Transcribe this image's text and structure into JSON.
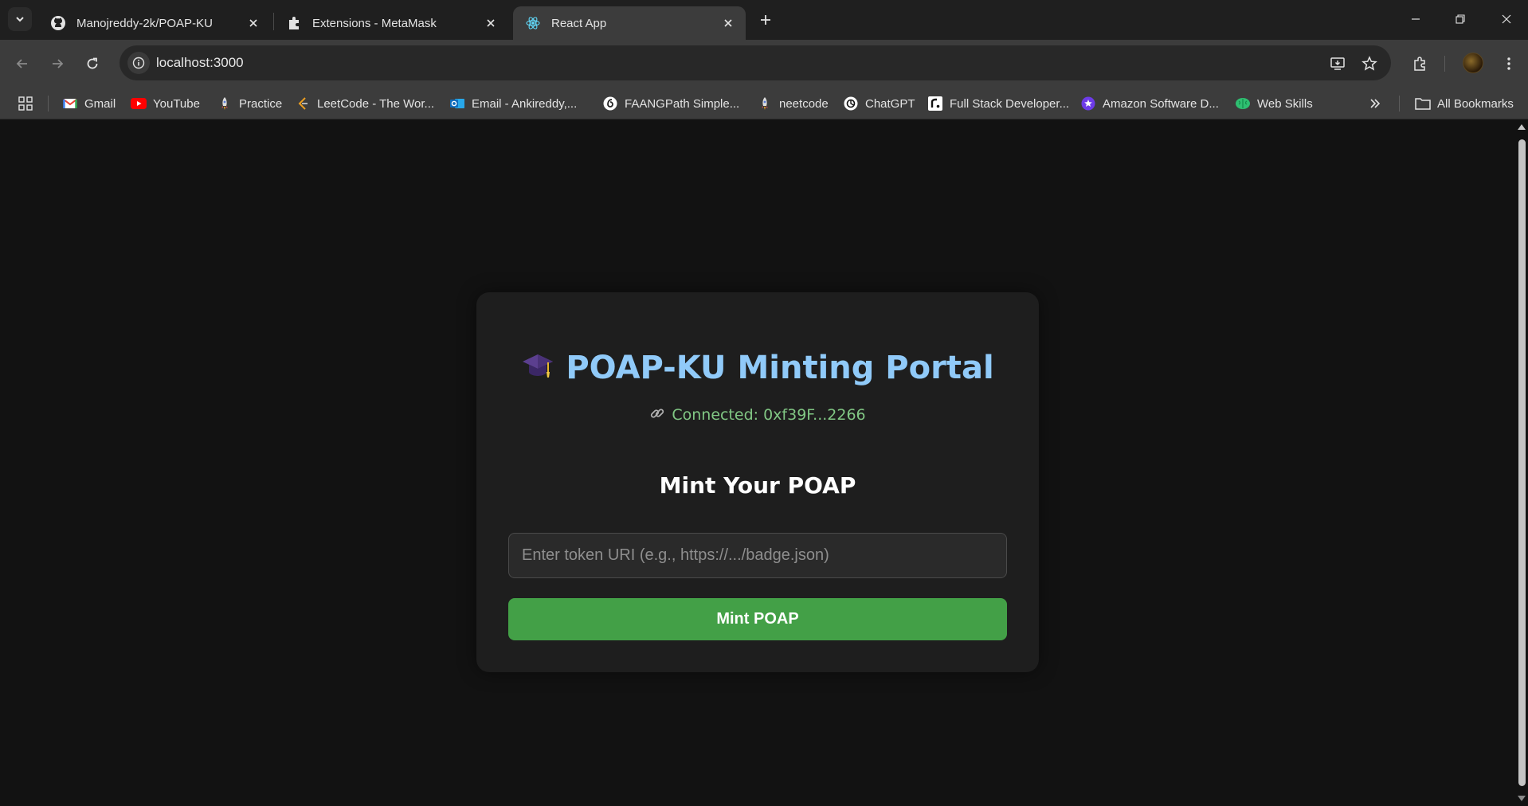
{
  "browser": {
    "tabs": [
      {
        "title": "Manojreddy-2k/POAP-KU",
        "icon": "github-icon"
      },
      {
        "title": "Extensions - MetaMask",
        "icon": "puzzle-icon"
      },
      {
        "title": "React App",
        "icon": "react-icon",
        "active": true
      }
    ],
    "url": "localhost:3000",
    "bookmarks": [
      {
        "label": "Gmail",
        "icon": "gmail-icon"
      },
      {
        "label": "YouTube",
        "icon": "youtube-icon"
      },
      {
        "label": "Practice",
        "icon": "rocket-icon"
      },
      {
        "label": "LeetCode - The Wor...",
        "icon": "leetcode-icon"
      },
      {
        "label": "Email - Ankireddy,...",
        "icon": "outlook-icon"
      },
      {
        "label": "FAANGPath Simple...",
        "icon": "faangpath-icon"
      },
      {
        "label": "neetcode",
        "icon": "rocket-icon"
      },
      {
        "label": "ChatGPT",
        "icon": "chatgpt-icon"
      },
      {
        "label": "Full Stack Developer...",
        "icon": "replit-icon"
      },
      {
        "label": "Amazon Software D...",
        "icon": "star-badge-icon"
      },
      {
        "label": "Web Skills",
        "icon": "brain-icon"
      }
    ],
    "all_bookmarks_label": "All Bookmarks"
  },
  "app": {
    "title": "POAP-KU Minting Portal",
    "title_icon": "graduation-cap-icon",
    "connected_text": "Connected: 0xf39F...2266",
    "connected_icon": "link-icon",
    "mint_heading": "Mint Your POAP",
    "token_input_placeholder": "Enter token URI (e.g., https://.../badge.json)",
    "token_input_value": "",
    "mint_button_label": "Mint POAP"
  },
  "colors": {
    "title": "#90caf9",
    "connected": "#81c784",
    "mint_button": "#43a047",
    "card_bg": "#1e1e1e",
    "page_bg": "#121212"
  }
}
